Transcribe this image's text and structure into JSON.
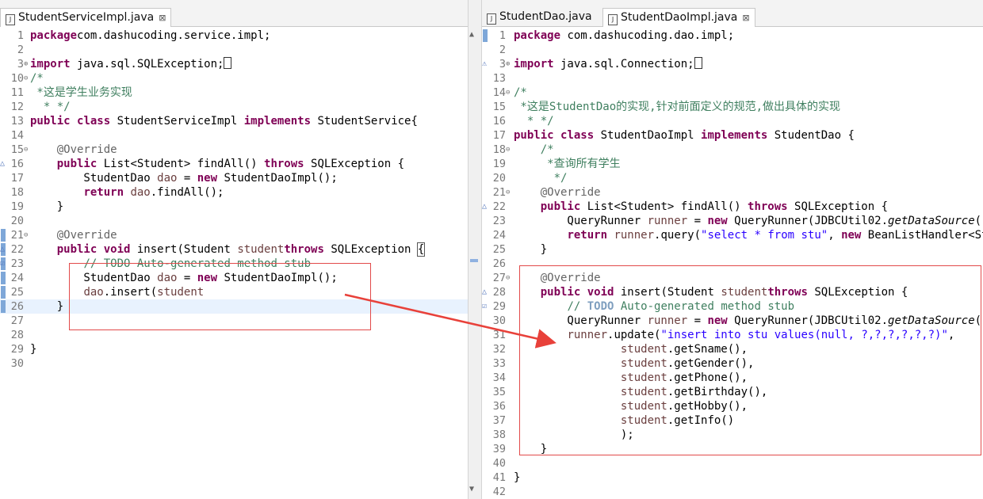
{
  "left": {
    "tab": {
      "label": "StudentServiceImpl.java",
      "close": "⊠"
    },
    "lines": [
      {
        "n": "1",
        "tokens": [
          [
            "kw",
            "package"
          ],
          [
            "",
            "com.dashucoding.service.impl;"
          ]
        ]
      },
      {
        "n": "2",
        "tokens": []
      },
      {
        "n": "3",
        "fold": "⊕",
        "tokens": [
          [
            "kw",
            "import"
          ],
          [
            "",
            " java.sql.SQLException;"
          ],
          [
            "box",
            ""
          ]
        ]
      },
      {
        "n": "10",
        "fold": "⊖",
        "tokens": [
          [
            "cm",
            "/*"
          ]
        ]
      },
      {
        "n": "11",
        "tokens": [
          [
            "cm",
            " *这是学生业务实现"
          ]
        ]
      },
      {
        "n": "12",
        "tokens": [
          [
            "cm",
            "  * */"
          ]
        ]
      },
      {
        "n": "13",
        "tokens": [
          [
            "kw",
            "public"
          ],
          [
            "",
            " "
          ],
          [
            "kw",
            "class"
          ],
          [
            "",
            " StudentServiceImpl "
          ],
          [
            "kw",
            "implements"
          ],
          [
            "",
            " StudentService{"
          ]
        ]
      },
      {
        "n": "14",
        "tokens": []
      },
      {
        "n": "15",
        "fold": "⊖",
        "tokens": [
          [
            "",
            "    "
          ],
          [
            "an",
            "@Override"
          ]
        ]
      },
      {
        "n": "16",
        "marker": "△",
        "tokens": [
          [
            "",
            "    "
          ],
          [
            "kw",
            "public"
          ],
          [
            "",
            " List<Student> findAll() "
          ],
          [
            "kw",
            "throws"
          ],
          [
            "",
            " SQLException {"
          ]
        ]
      },
      {
        "n": "17",
        "tokens": [
          [
            "",
            "        StudentDao "
          ],
          [
            "fld",
            "dao"
          ],
          [
            "",
            " = "
          ],
          [
            "kw",
            "new"
          ],
          [
            "",
            " StudentDaoImpl();"
          ]
        ]
      },
      {
        "n": "18",
        "tokens": [
          [
            "",
            "        "
          ],
          [
            "kw",
            "return"
          ],
          [
            "",
            " "
          ],
          [
            "fld",
            "dao"
          ],
          [
            "",
            ".findAll();"
          ]
        ]
      },
      {
        "n": "19",
        "tokens": [
          [
            "",
            "    }"
          ]
        ]
      },
      {
        "n": "20",
        "tokens": []
      },
      {
        "n": "21",
        "fold": "⊖",
        "bar": true,
        "tokens": [
          [
            "",
            "    "
          ],
          [
            "an",
            "@Override"
          ]
        ]
      },
      {
        "n": "22",
        "marker": "△",
        "bar": true,
        "tokens": [
          [
            "",
            "    "
          ],
          [
            "kw",
            "public"
          ],
          [
            "",
            " "
          ],
          [
            "kw",
            "void"
          ],
          [
            "",
            " insert(Student "
          ],
          [
            "fld",
            "student"
          ],
          [
            ") "
          ],
          [
            "kw",
            "throws"
          ],
          [
            "",
            " SQLException "
          ],
          [
            "box2",
            "{"
          ]
        ]
      },
      {
        "n": "23",
        "marker": "☑",
        "bar": true,
        "tokens": [
          [
            "",
            "        "
          ],
          [
            "cm strike",
            "// TODO Auto-generated method stub"
          ]
        ]
      },
      {
        "n": "24",
        "bar": true,
        "tokens": [
          [
            "",
            "        StudentDao "
          ],
          [
            "fld",
            "dao"
          ],
          [
            "",
            " = "
          ],
          [
            "kw",
            "new"
          ],
          [
            "",
            " StudentDaoImpl();"
          ]
        ]
      },
      {
        "n": "25",
        "bar": true,
        "tokens": [
          [
            "",
            "        "
          ],
          [
            "fld",
            "dao"
          ],
          [
            "",
            ".insert("
          ],
          [
            "fld",
            "student"
          ],
          [
            ");"
          ]
        ]
      },
      {
        "n": "26",
        "bar": true,
        "current": true,
        "tokens": [
          [
            "",
            "    }"
          ]
        ]
      },
      {
        "n": "27",
        "tokens": []
      },
      {
        "n": "28",
        "tokens": []
      },
      {
        "n": "29",
        "tokens": [
          [
            "",
            "}"
          ]
        ]
      },
      {
        "n": "30",
        "tokens": []
      }
    ]
  },
  "right": {
    "tabs": [
      {
        "label": "StudentDao.java",
        "active": false
      },
      {
        "label": "StudentDaoImpl.java",
        "active": true,
        "close": "⊠"
      }
    ],
    "lines": [
      {
        "n": "1",
        "bar": true,
        "tokens": [
          [
            "kw",
            "package"
          ],
          [
            "",
            " com.dashucoding.dao.impl;"
          ]
        ]
      },
      {
        "n": "2",
        "tokens": []
      },
      {
        "n": "3",
        "fold": "⊕",
        "marker": "⚠",
        "tokens": [
          [
            "kw",
            "import"
          ],
          [
            "",
            " java.sql.Connection;"
          ],
          [
            "box",
            ""
          ]
        ]
      },
      {
        "n": "13",
        "tokens": []
      },
      {
        "n": "14",
        "fold": "⊖",
        "tokens": [
          [
            "cm",
            "/*"
          ]
        ]
      },
      {
        "n": "15",
        "tokens": [
          [
            "cm",
            " *这是StudentDao的实现,针对前面定义的规范,做出具体的实现"
          ]
        ]
      },
      {
        "n": "16",
        "tokens": [
          [
            "cm",
            "  * */"
          ]
        ]
      },
      {
        "n": "17",
        "tokens": [
          [
            "kw",
            "public"
          ],
          [
            "",
            " "
          ],
          [
            "kw",
            "class"
          ],
          [
            "",
            " StudentDaoImpl "
          ],
          [
            "kw",
            "implements"
          ],
          [
            "",
            " StudentDao {"
          ]
        ]
      },
      {
        "n": "18",
        "fold": "⊖",
        "tokens": [
          [
            "",
            "    "
          ],
          [
            "cm",
            "/*"
          ]
        ]
      },
      {
        "n": "19",
        "tokens": [
          [
            "",
            "    "
          ],
          [
            "cm",
            " *查询所有学生"
          ]
        ]
      },
      {
        "n": "20",
        "tokens": [
          [
            "",
            "    "
          ],
          [
            "cm",
            "  */"
          ]
        ]
      },
      {
        "n": "21",
        "fold": "⊖",
        "tokens": [
          [
            "",
            "    "
          ],
          [
            "an",
            "@Override"
          ]
        ]
      },
      {
        "n": "22",
        "marker": "△",
        "tokens": [
          [
            "",
            "    "
          ],
          [
            "kw",
            "public"
          ],
          [
            "",
            " List<Student> findAll() "
          ],
          [
            "kw",
            "throws"
          ],
          [
            "",
            " SQLException {"
          ]
        ]
      },
      {
        "n": "23",
        "tokens": [
          [
            "",
            "        QueryRunner "
          ],
          [
            "fld",
            "runner"
          ],
          [
            "",
            " = "
          ],
          [
            "kw",
            "new"
          ],
          [
            "",
            " QueryRunner(JDBCUtil02."
          ],
          [
            "it",
            "getDataSource"
          ],
          [
            "",
            "());"
          ]
        ]
      },
      {
        "n": "24",
        "tokens": [
          [
            "",
            "        "
          ],
          [
            "kw",
            "return"
          ],
          [
            "",
            " "
          ],
          [
            "fld",
            "runner"
          ],
          [
            "",
            ".query("
          ],
          [
            "str",
            "\"select * from stu\""
          ],
          [
            "",
            ", "
          ],
          [
            "kw",
            "new"
          ],
          [
            "",
            " BeanListHandler<Stude"
          ]
        ]
      },
      {
        "n": "25",
        "tokens": [
          [
            "",
            "    }"
          ]
        ]
      },
      {
        "n": "26",
        "tokens": []
      },
      {
        "n": "27",
        "fold": "⊖",
        "tokens": [
          [
            "",
            "    "
          ],
          [
            "an",
            "@Override"
          ]
        ]
      },
      {
        "n": "28",
        "marker": "△",
        "tokens": [
          [
            "",
            "    "
          ],
          [
            "kw",
            "public"
          ],
          [
            "",
            " "
          ],
          [
            "kw",
            "void"
          ],
          [
            "",
            " insert(Student "
          ],
          [
            "fld",
            "student"
          ],
          [
            ") "
          ],
          [
            "kw",
            "throws"
          ],
          [
            "",
            " SQLException {"
          ]
        ]
      },
      {
        "n": "29",
        "marker": "☑",
        "tokens": [
          [
            "",
            "        "
          ],
          [
            "cm",
            "// "
          ],
          [
            "todo",
            "TODO"
          ],
          [
            "cm",
            " Auto-generated method stub"
          ]
        ]
      },
      {
        "n": "30",
        "tokens": [
          [
            "",
            "        QueryRunner "
          ],
          [
            "fld",
            "runner"
          ],
          [
            "",
            " = "
          ],
          [
            "kw",
            "new"
          ],
          [
            "",
            " QueryRunner(JDBCUtil02."
          ],
          [
            "it",
            "getDataSource"
          ],
          [
            "",
            "());"
          ]
        ]
      },
      {
        "n": "31",
        "tokens": [
          [
            "",
            "        "
          ],
          [
            "fld",
            "runner"
          ],
          [
            "",
            ".update("
          ],
          [
            "str",
            "\"insert into stu values(null, ?,?,?,?,?,?)\""
          ],
          [
            "",
            ","
          ]
        ]
      },
      {
        "n": "32",
        "tokens": [
          [
            "",
            "                "
          ],
          [
            "fld",
            "student"
          ],
          [
            "",
            ".getSname(),"
          ]
        ]
      },
      {
        "n": "33",
        "tokens": [
          [
            "",
            "                "
          ],
          [
            "fld",
            "student"
          ],
          [
            "",
            ".getGender(),"
          ]
        ]
      },
      {
        "n": "34",
        "tokens": [
          [
            "",
            "                "
          ],
          [
            "fld",
            "student"
          ],
          [
            "",
            ".getPhone(),"
          ]
        ]
      },
      {
        "n": "35",
        "tokens": [
          [
            "",
            "                "
          ],
          [
            "fld",
            "student"
          ],
          [
            "",
            ".getBirthday(),"
          ]
        ]
      },
      {
        "n": "36",
        "tokens": [
          [
            "",
            "                "
          ],
          [
            "fld",
            "student"
          ],
          [
            "",
            ".getHobby(),"
          ]
        ]
      },
      {
        "n": "37",
        "tokens": [
          [
            "",
            "                "
          ],
          [
            "fld",
            "student"
          ],
          [
            "",
            ".getInfo()"
          ]
        ]
      },
      {
        "n": "38",
        "tokens": [
          [
            "",
            "                );"
          ]
        ]
      },
      {
        "n": "39",
        "tokens": [
          [
            "",
            "    }"
          ]
        ]
      },
      {
        "n": "40",
        "tokens": []
      },
      {
        "n": "41",
        "fold": "",
        "tokens": [
          [
            "",
            "}"
          ]
        ]
      },
      {
        "n": "42",
        "tokens": []
      }
    ]
  },
  "colors": {
    "keyword": "#7f0055",
    "comment": "#3f7f5f",
    "annotation_box": "#e24a4a",
    "arrow": "#e8413a"
  }
}
